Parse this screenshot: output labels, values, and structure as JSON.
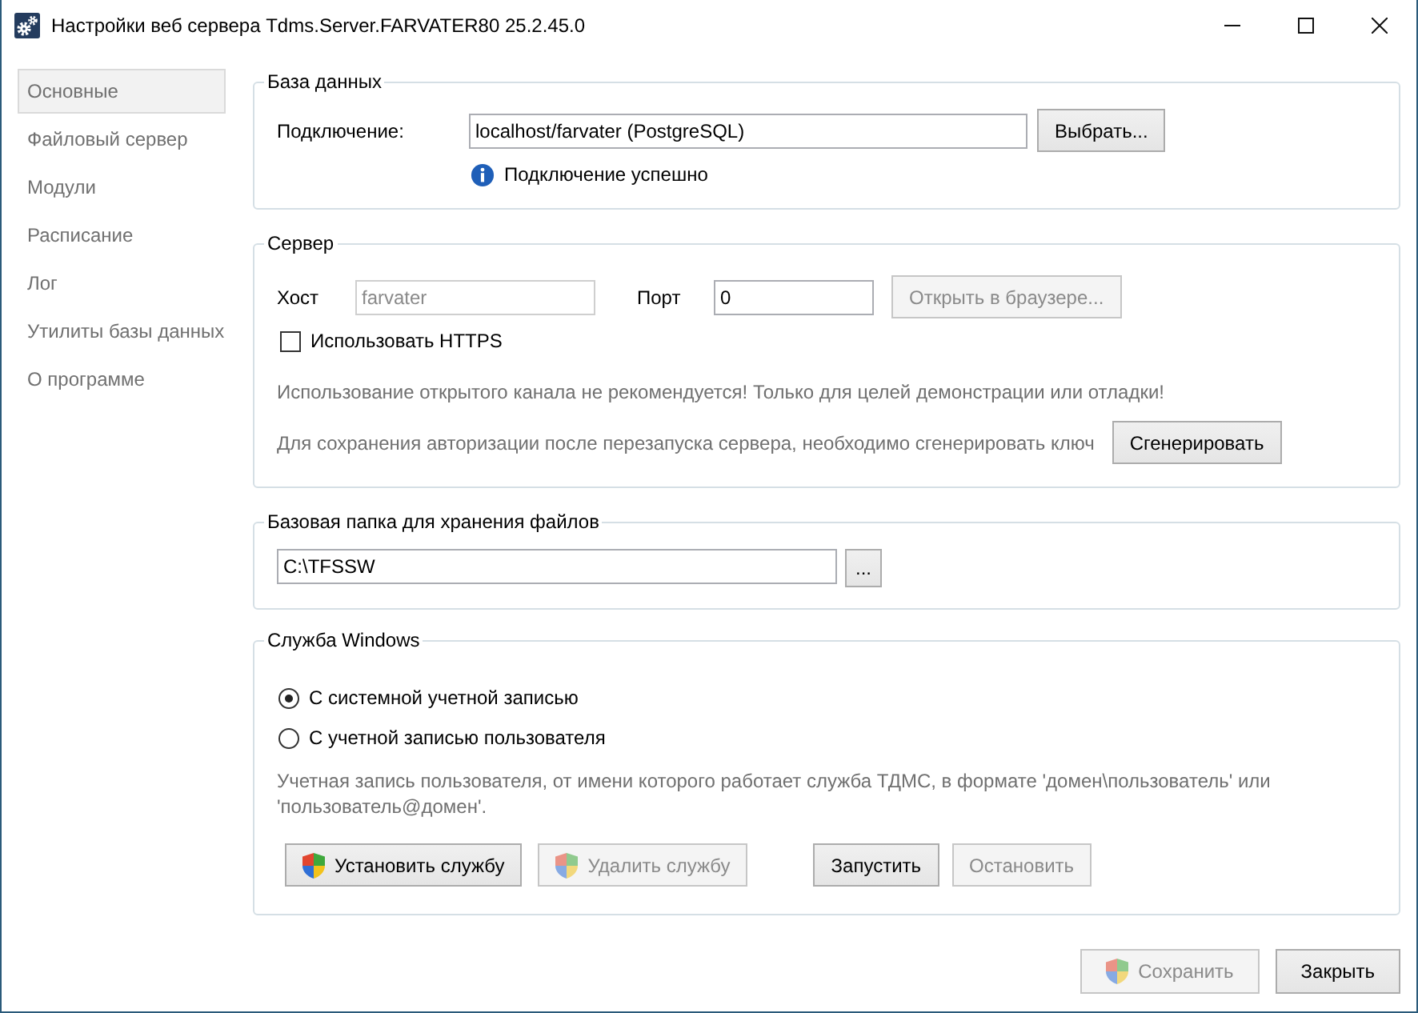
{
  "window": {
    "title": "Настройки веб сервера Tdms.Server.FARVATER80 25.2.45.0"
  },
  "sidebar": {
    "items": [
      {
        "label": "Основные",
        "selected": true
      },
      {
        "label": "Файловый сервер",
        "selected": false
      },
      {
        "label": "Модули",
        "selected": false
      },
      {
        "label": "Расписание",
        "selected": false
      },
      {
        "label": "Лог",
        "selected": false
      },
      {
        "label": "Утилиты базы данных",
        "selected": false
      },
      {
        "label": "О программе",
        "selected": false
      }
    ]
  },
  "database": {
    "title": "База данных",
    "connection_label": "Подключение:",
    "connection_value": "localhost/farvater (PostgreSQL)",
    "choose_button": {
      "label": "Выбрать...",
      "disabled": false
    },
    "status": "Подключение успешно"
  },
  "server": {
    "title": "Сервер",
    "host_label": "Хост",
    "host_field": {
      "value": "farvater",
      "disabled": true
    },
    "port_label": "Порт",
    "port_field": {
      "value": "0",
      "disabled": false
    },
    "open_button": {
      "label": "Открыть в браузере...",
      "disabled": true
    },
    "https": {
      "label": "Использовать HTTPS",
      "checked": false
    },
    "warning": "Использование открытого канала не рекомендуется! Только для целей демонстрации или отладки!",
    "key_note": "Для сохранения авторизации после перезапуска сервера, необходимо сгенерировать ключ",
    "generate_button": {
      "label": "Сгенерировать",
      "disabled": false
    }
  },
  "storage": {
    "title": "Базовая папка для хранения файлов",
    "path_value": "C:\\TFSSW",
    "browse_button": {
      "label": "...",
      "disabled": false
    }
  },
  "service": {
    "title": "Служба Windows",
    "accounts": [
      {
        "label": "С системной учетной записью",
        "selected": true
      },
      {
        "label": "С учетной записью пользователя",
        "selected": false
      }
    ],
    "note": "Учетная запись пользователя, от имени которого работает служба ТДМС, в формате 'домен\\пользователь' или 'пользователь@домен'.",
    "buttons": [
      {
        "kind": "elevated",
        "label": "Установить службу",
        "disabled": false
      },
      {
        "kind": "elevated",
        "label": "Удалить службу",
        "disabled": true
      },
      {
        "kind": "plain",
        "label": "Запустить",
        "disabled": false
      },
      {
        "kind": "plain",
        "label": "Остановить",
        "disabled": true
      }
    ]
  },
  "footer": {
    "buttons": [
      {
        "kind": "elevated",
        "label": "Сохранить",
        "disabled": true
      },
      {
        "kind": "plain",
        "label": "Закрыть",
        "disabled": false
      }
    ]
  }
}
